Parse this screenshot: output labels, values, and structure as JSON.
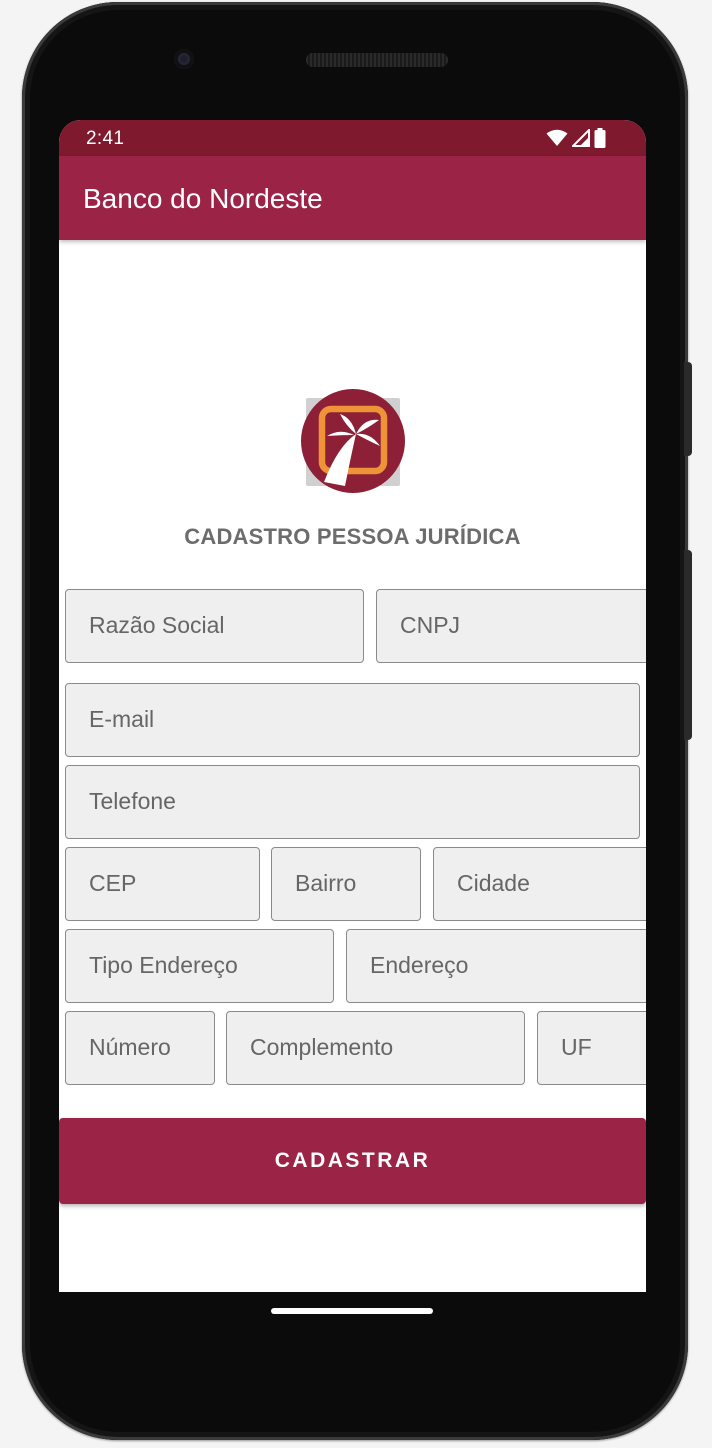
{
  "status_bar": {
    "time": "2:41",
    "icons": [
      "wifi-icon",
      "signal-icon",
      "battery-icon"
    ]
  },
  "app_bar": {
    "title": "Banco do Nordeste"
  },
  "logo": {
    "icon": "banco-do-nordeste-logo-icon",
    "colors": {
      "circle": "#8d1f36",
      "frame": "#f09237",
      "palm": "#ffffff"
    }
  },
  "form": {
    "title": "CADASTRO PESSOA JURÍDICA",
    "fields": {
      "razao_social": {
        "placeholder": "Razão Social"
      },
      "cnpj": {
        "placeholder": "CNPJ"
      },
      "email": {
        "placeholder": "E-mail"
      },
      "telefone": {
        "placeholder": "Telefone"
      },
      "cep": {
        "placeholder": "CEP"
      },
      "bairro": {
        "placeholder": "Bairro"
      },
      "cidade": {
        "placeholder": "Cidade"
      },
      "tipo_endereco": {
        "placeholder": "Tipo Endereço"
      },
      "endereco": {
        "placeholder": "Endereço"
      },
      "numero": {
        "placeholder": "Número"
      },
      "complemento": {
        "placeholder": "Complemento"
      },
      "uf": {
        "placeholder": "UF"
      }
    },
    "submit_label": "CADASTRAR"
  },
  "colors": {
    "status_bar": "#7f1a2e",
    "primary": "#9a2346",
    "field_bg": "#efefef",
    "field_border": "#8a8a8a",
    "hint_text": "#666666",
    "title_text": "#6c6c6c"
  }
}
